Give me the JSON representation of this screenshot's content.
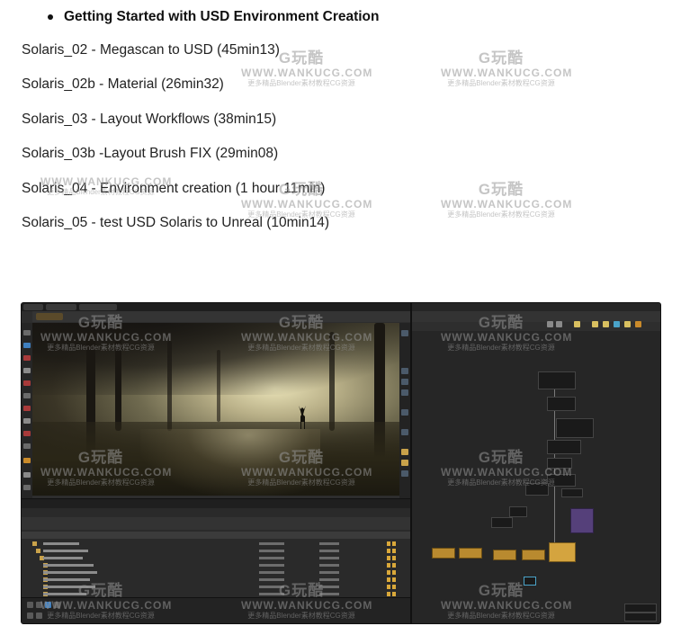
{
  "section": {
    "title": "Getting Started with USD Environment Creation"
  },
  "lessons": [
    "Solaris_02 - Megascan to USD (45min13)",
    "Solaris_02b - Material (26min32)",
    "Solaris_03 - Layout Workflows (38min15)",
    "Solaris_03b -Layout Brush FIX (29min08)",
    "Solaris_04 - Environment creation (1 hour 11min)",
    "Solaris_05 - test USD Solaris to Unreal (10min14)"
  ],
  "watermark": {
    "logo": "G玩酷",
    "url": "WWW.WANKUCG.COM",
    "sub": "更多精品Blender素材教程CG资源"
  },
  "colors": {
    "text": "#222222",
    "app_bg": "#2d2d2d",
    "node_orange": "#b98a2f",
    "node_purple": "#55407a",
    "node_gold": "#d4a43f"
  }
}
